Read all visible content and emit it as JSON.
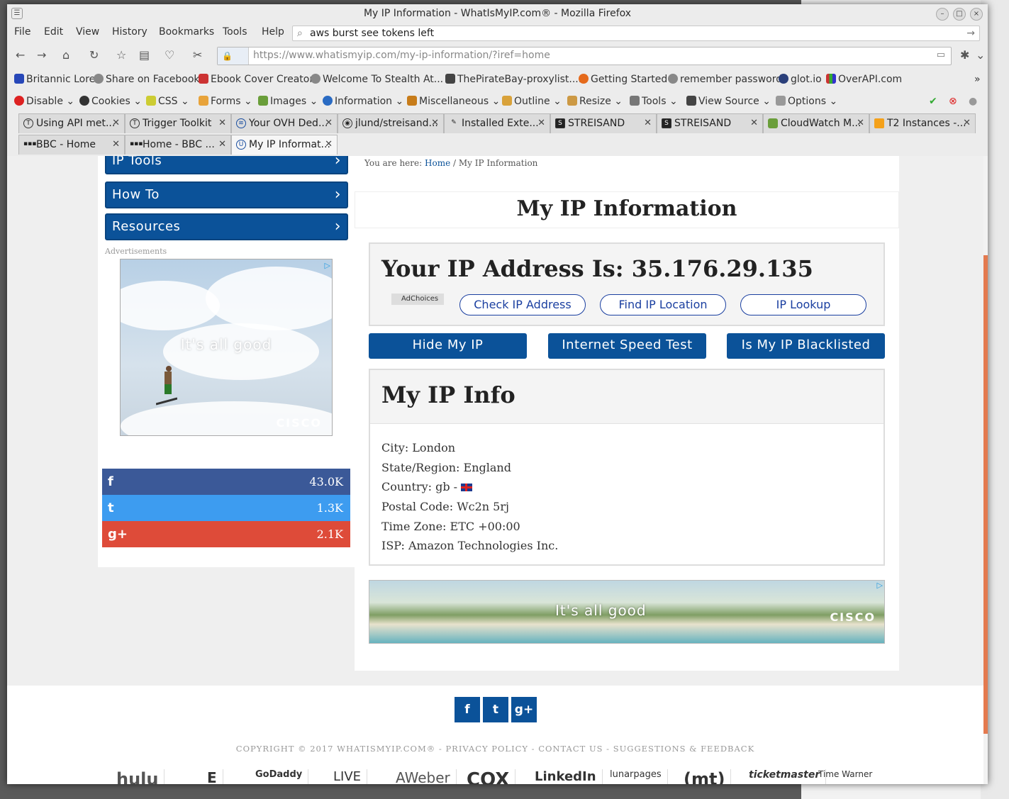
{
  "window": {
    "title": "My IP Information - WhatIsMyIP.com® - Mozilla Firefox"
  },
  "menu": [
    "File",
    "Edit",
    "View",
    "History",
    "Bookmarks",
    "Tools",
    "Help"
  ],
  "search": {
    "value": "aws burst see tokens left"
  },
  "urlbar": {
    "host": "https://www.whatismyip.com",
    "path": "/my-ip-information/?iref=home"
  },
  "bookmarks": [
    "Britannic Lore",
    "Share on Facebook",
    "Ebook Cover Creator",
    "Welcome To Stealth At...",
    "ThePirateBay-proxylist....",
    "Getting Started",
    "remember password",
    "glot.io",
    "OverAPI.com"
  ],
  "webdev": [
    "Disable",
    "Cookies",
    "CSS",
    "Forms",
    "Images",
    "Information",
    "Miscellaneous",
    "Outline",
    "Resize",
    "Tools",
    "View Source",
    "Options"
  ],
  "tabs_row1": [
    "Using API met...",
    "Trigger Toolkit",
    "Your OVH Ded...",
    "jlund/streisand...",
    "Installed Exte...",
    "STREISAND",
    "STREISAND",
    "CloudWatch M...",
    "T2 Instances -..."
  ],
  "tabs_row2": [
    "BBC - Home",
    "Home - BBC ...",
    "My IP Informat..."
  ],
  "sidebar": {
    "buttons": [
      "IP Tools",
      "How To",
      "Resources"
    ],
    "ad_label": "Advertisements",
    "ad_tagline": "It's all good",
    "ad_brand": "CISCO",
    "share": [
      {
        "icon": "f",
        "count": "43.0K",
        "color": "#3b5998"
      },
      {
        "icon": "t",
        "count": "1.3K",
        "color": "#3d9cf0"
      },
      {
        "icon": "g+",
        "count": "2.1K",
        "color": "#de4b39"
      }
    ]
  },
  "breadcrumb": {
    "prefix": "You are here:",
    "home": "Home",
    "sep": "/",
    "current": "My IP Information"
  },
  "main": {
    "title": "My IP Information",
    "ip_line": "Your IP Address Is: 35.176.29.135",
    "adchoices": "AdChoices",
    "pills": [
      "Check IP Address",
      "Find IP Location",
      "IP Lookup"
    ],
    "buttons": [
      "Hide My IP",
      "Internet Speed Test",
      "Is My IP Blacklisted"
    ],
    "info_title": "My IP Info",
    "info": [
      "City: London",
      "State/Region: England",
      "Country: gb -",
      "Postal Code: Wc2n 5rj",
      "Time Zone: ETC +00:00",
      "ISP: Amazon Technologies Inc."
    ],
    "banner_tagline": "It's all good",
    "banner_brand": "CISCO"
  },
  "footer": {
    "copyright": "COPYRIGHT © 2017 WHATISMYIP.COM® - PRIVACY POLICY - CONTACT US - SUGGESTIONS & FEEDBACK",
    "social": [
      "f",
      "t",
      "g+"
    ],
    "logos": [
      "hulu",
      "E",
      "GoDaddy",
      "LIVE",
      "AWeber",
      "COX",
      "LinkedIn",
      "lunarpages",
      "(mt)",
      "ticketmaster",
      "Time Warner"
    ]
  }
}
